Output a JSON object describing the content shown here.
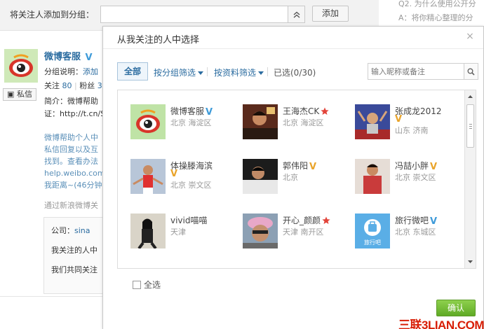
{
  "topbar": {
    "label": "将关注人添加到分组：",
    "group_input_value": "",
    "add_button": "添加"
  },
  "faq": {
    "q2": "Q2. 为什么使用公开分",
    "a": "A：将你精心整理的分"
  },
  "background_profile": {
    "name": "微博客服",
    "message_button": "私信",
    "group_desc": "分组说明：",
    "group_desc_link": "添加",
    "follow_label": "关注",
    "follow_count": "80",
    "fans_label": "粉丝",
    "fans_count": "3",
    "intro": "简介：微博帮助",
    "cert": "证：http://t.cn/S",
    "para_lines": [
      "微博帮助个人中",
      "私信回复以及互",
      "找到。查看办法",
      "help.weibo.com",
      "我距离~(46分钟"
    ],
    "source": "通过新浪微博关",
    "company_label": "公司：",
    "company_value": "sina",
    "i_follow": "我关注的人中",
    "mutual": "我们共同关注"
  },
  "dialog": {
    "title": "从我关注的人中选择",
    "close": "×",
    "tabs": {
      "all": "全部",
      "by_group": "按分组筛选",
      "by_profile": "按资料筛选",
      "selected": "已选(0/30)"
    },
    "search_placeholder": "输入昵称或备注",
    "users": [
      {
        "name": "微博客服",
        "location": "北京 海淀区",
        "badge": "blue-v",
        "avatar_color": "#bfe3a6"
      },
      {
        "name": "王海杰CK",
        "location": "北京 海淀区",
        "badge": "red-star",
        "avatar_color": "#5a2a1c"
      },
      {
        "name": "张成龙2012",
        "location": "山东 济南",
        "badge": "gold-v",
        "avatar_color": "#3a4a9a"
      },
      {
        "name": "体操滕海滨",
        "location": "北京 崇文区",
        "badge": "gold-v",
        "avatar_color": "#b8c6d8"
      },
      {
        "name": "郭伟阳",
        "location": "北京",
        "badge": "gold-v",
        "avatar_color": "#1c1c1c"
      },
      {
        "name": "冯喆小胖",
        "location": "北京 崇文区",
        "badge": "gold-v",
        "avatar_color": "#c93b3b"
      },
      {
        "name": "vivid喵喵",
        "location": "天津",
        "badge": "",
        "avatar_color": "#3a3a3a"
      },
      {
        "name": "开心_颜颜",
        "location": "天津 南开区",
        "badge": "red-star",
        "avatar_color": "#c9a0b8"
      },
      {
        "name": "旅行微吧",
        "location": "北京 东城区",
        "badge": "blue-v",
        "avatar_color": "#5aaee6",
        "avatar_text": "旅行吧"
      }
    ],
    "select_all": "全选",
    "confirm": "确认"
  },
  "watermark": "三联3LIAN.COM",
  "colors": {
    "link_blue": "#2b6ca0",
    "blue_v": "#3f9bd9",
    "gold_v": "#e9a42b",
    "confirm_green": "#6ab52e"
  }
}
